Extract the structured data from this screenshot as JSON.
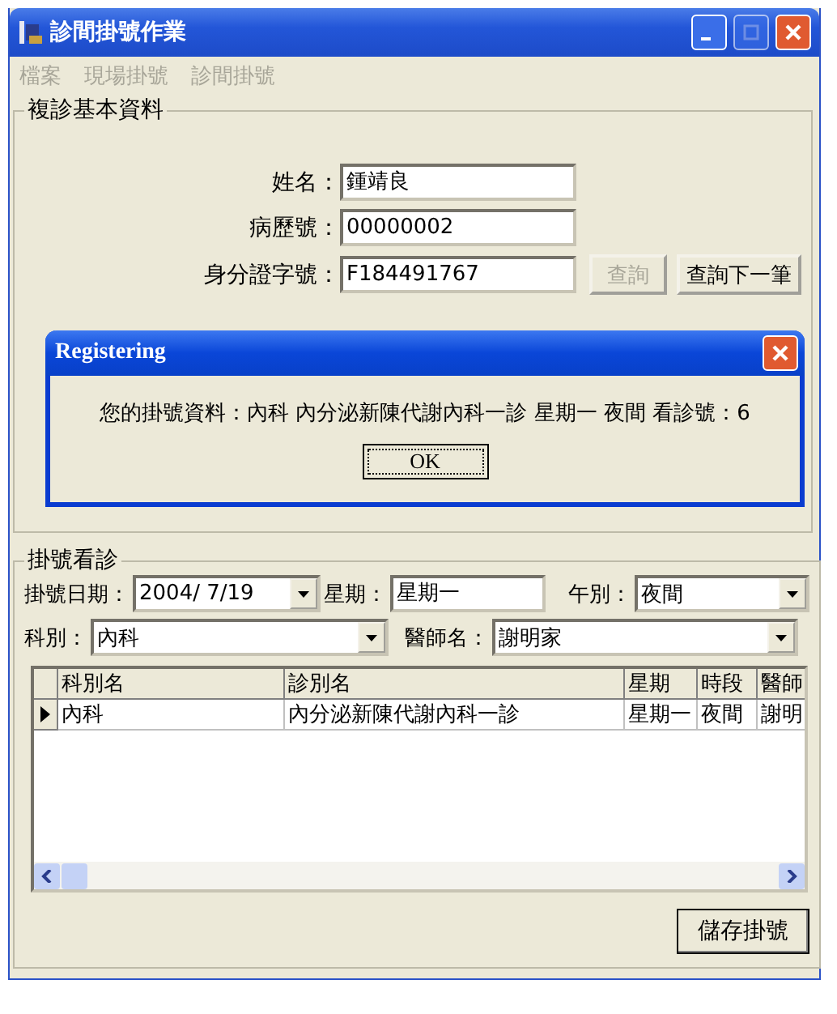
{
  "window": {
    "title": "診間掛號作業"
  },
  "menu": [
    {
      "label": "檔案",
      "disabled": true
    },
    {
      "label": "現場掛號",
      "disabled": true
    },
    {
      "label": "診間掛號",
      "disabled": true
    }
  ],
  "basic_group": {
    "title": "複診基本資料",
    "fields": [
      {
        "label": "姓名：",
        "value": "鍾靖良"
      },
      {
        "label": "病歷號：",
        "value": "00000002"
      },
      {
        "label": "身分證字號：",
        "value": "F184491767"
      }
    ],
    "buttons": [
      {
        "label": "查詢",
        "disabled": true
      },
      {
        "label": "查詢下一筆",
        "disabled": false
      }
    ]
  },
  "dialog": {
    "title": "Registering",
    "message": "您的掛號資料：內科 內分泌新陳代謝內科一診 星期一 夜間 看診號：6",
    "button": "OK"
  },
  "register_group": {
    "title": "掛號看診",
    "date": {
      "label": "掛號日期：",
      "value": "2004/ 7/19"
    },
    "weekday": {
      "label": "星期：",
      "value": "星期一"
    },
    "session": {
      "label": "午別：",
      "value": "夜間"
    },
    "department": {
      "label": "科別：",
      "value": "內科"
    },
    "doctor": {
      "label": "醫師名：",
      "value": "謝明家"
    }
  },
  "table": {
    "columns": [
      "科別名",
      "診別名",
      "星期",
      "時段",
      "醫師"
    ],
    "rows": [
      {
        "cells": [
          "內科",
          "內分泌新陳代謝內科一診",
          "星期一",
          "夜間",
          "謝明"
        ],
        "selected": true
      }
    ]
  },
  "save_button": "儲存掛號"
}
